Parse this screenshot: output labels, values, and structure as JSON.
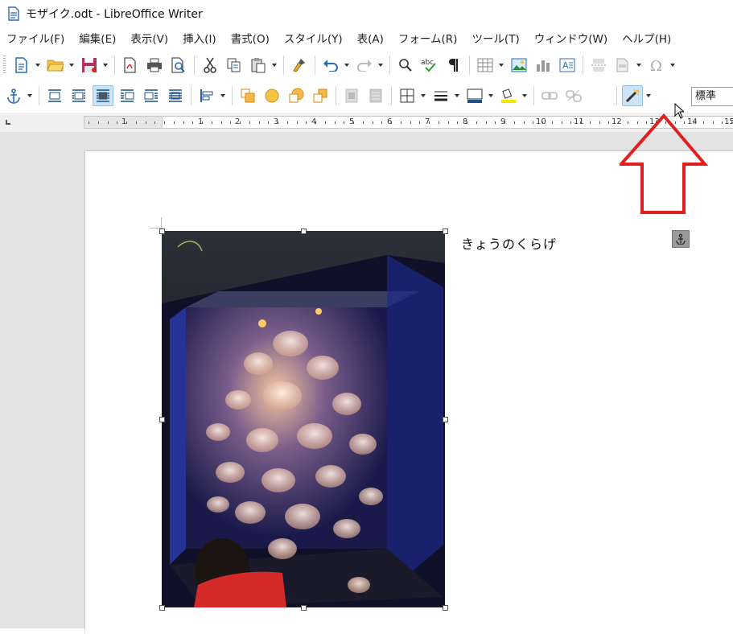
{
  "window": {
    "title": "モザイク.odt - LibreOffice Writer"
  },
  "menu": [
    "ファイル(F)",
    "編集(E)",
    "表示(V)",
    "挿入(I)",
    "書式(O)",
    "スタイル(Y)",
    "表(A)",
    "フォーム(R)",
    "ツール(T)",
    "ウィンドウ(W)",
    "ヘルプ(H)"
  ],
  "toolbar1": {
    "icons": [
      "new-document-icon",
      "open-folder-icon",
      "save-icon",
      "export-pdf-icon",
      "print-icon",
      "print-preview-icon",
      "cut-icon",
      "copy-icon",
      "paste-icon",
      "clone-formatting-icon",
      "undo-icon",
      "redo-icon",
      "find-replace-icon",
      "spelling-icon",
      "formatting-marks-icon",
      "insert-table-icon",
      "insert-image-icon",
      "insert-chart-icon",
      "insert-textbox-icon",
      "page-break-icon",
      "insert-field-icon",
      "special-character-icon"
    ]
  },
  "toolbar2": {
    "icons": [
      "anchor-icon",
      "wrap-off-icon",
      "page-wrap-icon",
      "optimal-wrap-icon",
      "wrap-left-icon",
      "wrap-right-icon",
      "wrap-through-icon",
      "align-icon",
      "bring-to-front-icon",
      "forward-one-icon",
      "backward-one-icon",
      "send-to-back-icon",
      "to-foreground-icon",
      "to-background-icon",
      "borders-icon",
      "line-style-icon",
      "border-color-icon",
      "area-fill-icon",
      "link-frames-icon",
      "unlink-frames-icon",
      "image-filter-icon"
    ],
    "paragraph_style": "標準"
  },
  "ruler": {
    "labels": [
      "1",
      "1",
      "2",
      "3",
      "4",
      "5",
      "6",
      "7",
      "8",
      "9",
      "10",
      "11",
      "12",
      "13",
      "14",
      "15"
    ]
  },
  "document": {
    "text": "きょうのくらげ"
  },
  "colors": {
    "accent": "#e02020",
    "selection": "#cce4f7",
    "page": "#ffffff",
    "workspace": "#e3e3e3"
  }
}
